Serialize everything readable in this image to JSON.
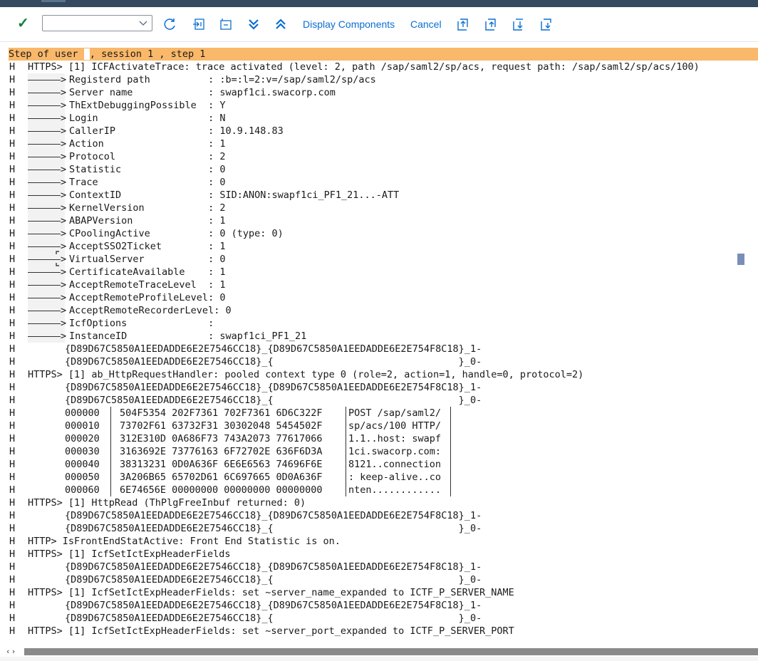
{
  "toolbar": {
    "confirm_icon": "checkmark-icon",
    "command_field": {
      "value": "",
      "placeholder": ""
    },
    "buttons": {
      "display_components": "Display Components",
      "cancel": "Cancel"
    },
    "icons": [
      "refresh-icon",
      "expand-all-icon",
      "collapse-all-icon",
      "double-chevron-down-icon",
      "double-chevron-up-icon",
      "export-icon",
      "upload-icon",
      "page-down-icon",
      "page-last-icon"
    ],
    "check_color": "#107e3e",
    "link_color": "#0a6ed1"
  },
  "trace": {
    "step_header": {
      "part1": "Step of user ",
      "part2": ", session 1 , step 1"
    },
    "highlight_color": "#f9b86a",
    "marker": "H",
    "lines": [
      {
        "kind": "text",
        "text": "HTTPS> [1] ICFActivateTrace: trace activated (level: 2, path /sap/saml2/sp/acs, request path: /sap/saml2/sp/acs/100)"
      },
      {
        "kind": "kv",
        "text": "Registerd path          : :b=:l=2:v=/sap/saml2/sp/acs"
      },
      {
        "kind": "kv",
        "text": "Server name             : swapf1ci.swacorp.com"
      },
      {
        "kind": "kv",
        "text": "ThExtDebuggingPossible  : Y"
      },
      {
        "kind": "kv",
        "text": "Login                   : N"
      },
      {
        "kind": "kv",
        "text": "CallerIP                : 10.9.148.83"
      },
      {
        "kind": "kv",
        "text": "Action                  : 1"
      },
      {
        "kind": "kv",
        "text": "Protocol                : 2"
      },
      {
        "kind": "kv",
        "text": "Statistic               : 0"
      },
      {
        "kind": "kv",
        "text": "Trace                   : 0"
      },
      {
        "kind": "kv",
        "text": "ContextID               : SID:ANON:swapf1ci_PF1_21...-ATT"
      },
      {
        "kind": "kv",
        "text": "KernelVersion           : 2"
      },
      {
        "kind": "kv",
        "text": "ABAPVersion             : 1"
      },
      {
        "kind": "kv",
        "text": "CPoolingActive          : 0 (type: 0)"
      },
      {
        "kind": "kv",
        "text": "AcceptSSO2Ticket        : 1"
      },
      {
        "kind": "kv",
        "text": "VirtualServer           : 0"
      },
      {
        "kind": "kv",
        "text": "CertificateAvailable    : 1"
      },
      {
        "kind": "kv",
        "text": "AcceptRemoteTraceLevel  : 1"
      },
      {
        "kind": "kv",
        "text": "AcceptRemoteProfileLevel: 0"
      },
      {
        "kind": "kv",
        "text": "AcceptRemoteRecorderLevel: 0"
      },
      {
        "kind": "kv",
        "text": "IcfOptions              :"
      },
      {
        "kind": "kv",
        "text": "InstanceID              : swapf1ci_PF1_21"
      },
      {
        "kind": "indent",
        "text": "{D89D67C5850A1EEDADDE6E2E7546CC18}_{D89D67C5850A1EEDADDE6E2E754F8C18}_1-"
      },
      {
        "kind": "indent",
        "text": "{D89D67C5850A1EEDADDE6E2E7546CC18}_{                                }_0-"
      },
      {
        "kind": "text",
        "text": "HTTPS> [1] ab_HttpRequestHandler: pooled context type 0 (role=2, action=1, handle=0, protocol=2)"
      },
      {
        "kind": "indent",
        "text": "{D89D67C5850A1EEDADDE6E2E7546CC18}_{D89D67C5850A1EEDADDE6E2E754F8C18}_1-"
      },
      {
        "kind": "indent",
        "text": "{D89D67C5850A1EEDADDE6E2E7546CC18}_{                                }_0-"
      },
      {
        "kind": "hex",
        "offset": "000000",
        "data": "504F5354 202F7361 702F7361 6D6C322F",
        "ascii": "POST /sap/saml2/"
      },
      {
        "kind": "hex",
        "offset": "000010",
        "data": "73702F61 63732F31 30302048 5454502F",
        "ascii": "sp/acs/100 HTTP/"
      },
      {
        "kind": "hex",
        "offset": "000020",
        "data": "312E310D 0A686F73 743A2073 77617066",
        "ascii": "1.1..host: swapf"
      },
      {
        "kind": "hex",
        "offset": "000030",
        "data": "3163692E 73776163 6F72702E 636F6D3A",
        "ascii": "1ci.swacorp.com:"
      },
      {
        "kind": "hex",
        "offset": "000040",
        "data": "38313231 0D0A636F 6E6E6563 74696F6E",
        "ascii": "8121..connection"
      },
      {
        "kind": "hex",
        "offset": "000050",
        "data": "3A206B65 65702D61 6C697665 0D0A636F",
        "ascii": ": keep-alive..co"
      },
      {
        "kind": "hex",
        "offset": "000060",
        "data": "6E74656E 00000000 00000000 00000000",
        "ascii": "nten............"
      },
      {
        "kind": "text",
        "text": "HTTPS> [1] HttpRead (ThPlgFreeInbuf returned: 0)"
      },
      {
        "kind": "indent",
        "text": "{D89D67C5850A1EEDADDE6E2E7546CC18}_{D89D67C5850A1EEDADDE6E2E754F8C18}_1-"
      },
      {
        "kind": "indent",
        "text": "{D89D67C5850A1EEDADDE6E2E7546CC18}_{                                }_0-"
      },
      {
        "kind": "text",
        "text": "HTTP> IsFrontEndStatActive: Front End Statistic is on."
      },
      {
        "kind": "text",
        "text": "HTTPS> [1] IcfSetIctExpHeaderFields"
      },
      {
        "kind": "indent",
        "text": "{D89D67C5850A1EEDADDE6E2E7546CC18}_{D89D67C5850A1EEDADDE6E2E754F8C18}_1-"
      },
      {
        "kind": "indent",
        "text": "{D89D67C5850A1EEDADDE6E2E7546CC18}_{                                }_0-"
      },
      {
        "kind": "text",
        "text": "HTTPS> [1] IcfSetIctExpHeaderFields: set ~server_name_expanded to ICTF_P_SERVER_NAME"
      },
      {
        "kind": "indent",
        "text": "{D89D67C5850A1EEDADDE6E2E7546CC18}_{D89D67C5850A1EEDADDE6E2E754F8C18}_1-"
      },
      {
        "kind": "indent",
        "text": "{D89D67C5850A1EEDADDE6E2E7546CC18}_{                                }_0-"
      },
      {
        "kind": "text",
        "text": "HTTPS> [1] IcfSetIctExpHeaderFields: set ~server_port_expanded to ICTF_P_SERVER_PORT"
      }
    ]
  },
  "scrollbar": {
    "arrows": "‹ ›"
  }
}
